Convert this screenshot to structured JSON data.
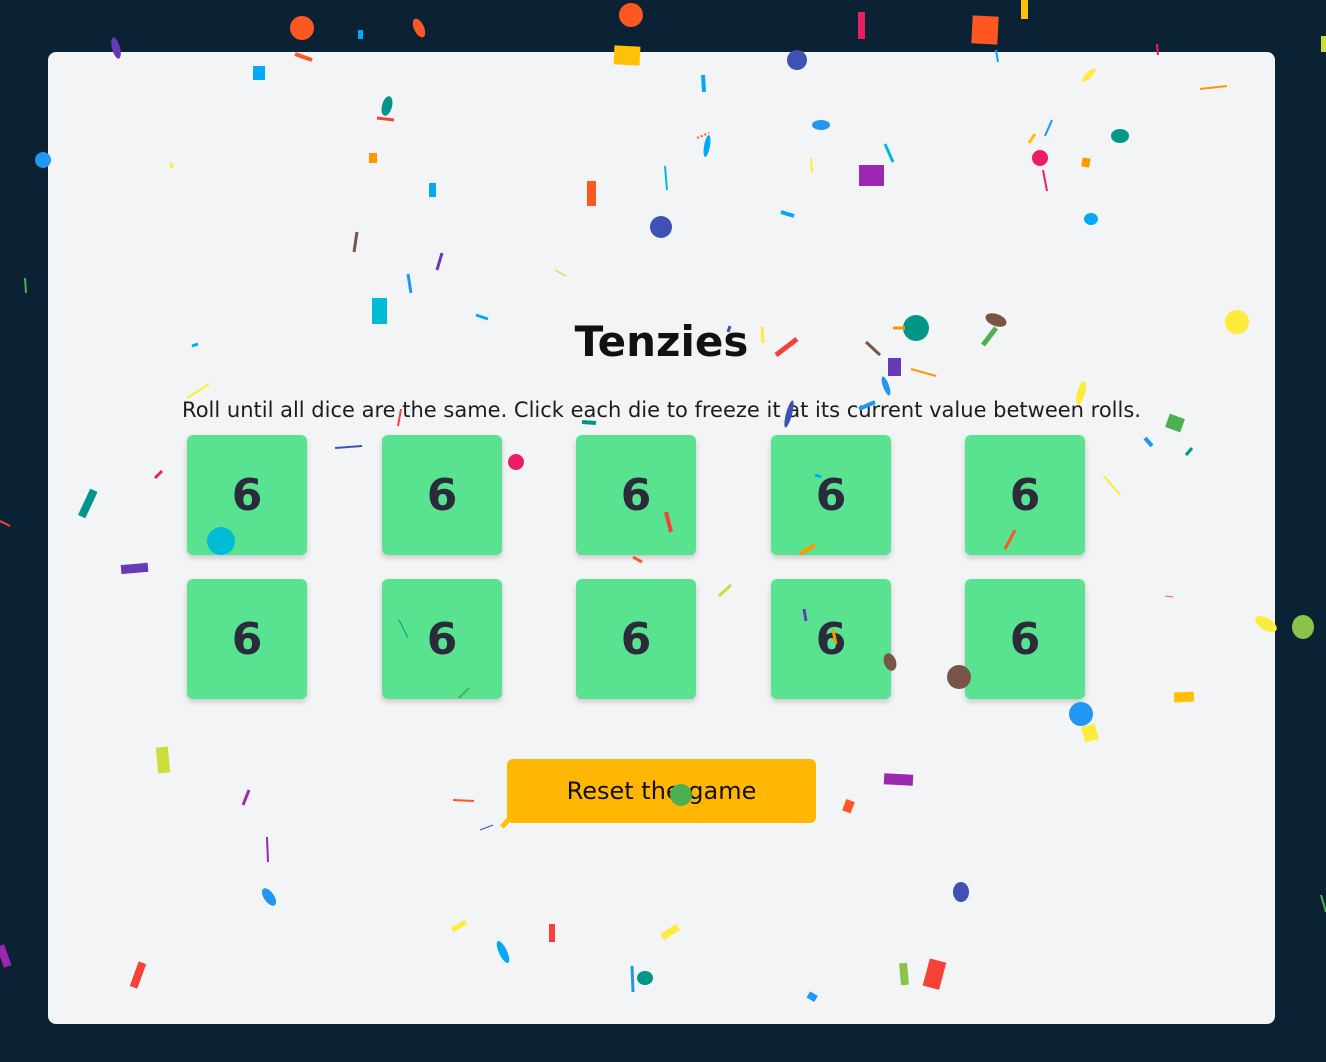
{
  "game": {
    "title": "Tenzies",
    "instructions": "Roll until all dice are the same. Click each die to freeze it at its current value between rolls.",
    "dice": [
      {
        "value": "6"
      },
      {
        "value": "6"
      },
      {
        "value": "6"
      },
      {
        "value": "6"
      },
      {
        "value": "6"
      },
      {
        "value": "6"
      },
      {
        "value": "6"
      },
      {
        "value": "6"
      },
      {
        "value": "6"
      },
      {
        "value": "6"
      }
    ],
    "reset_label": "Reset the game"
  },
  "colors": {
    "background": "#0b2234",
    "card": "#f3f4f6",
    "die": "#59e391",
    "button": "#ffb703",
    "confetti": [
      "#f44336",
      "#e91e63",
      "#9c27b0",
      "#673ab7",
      "#3f51b5",
      "#2196f3",
      "#03a9f4",
      "#00bcd4",
      "#009688",
      "#4caf50",
      "#8bc34a",
      "#cddc39",
      "#ffeb3b",
      "#ffc107",
      "#ff9800",
      "#ff5722",
      "#795548"
    ]
  }
}
